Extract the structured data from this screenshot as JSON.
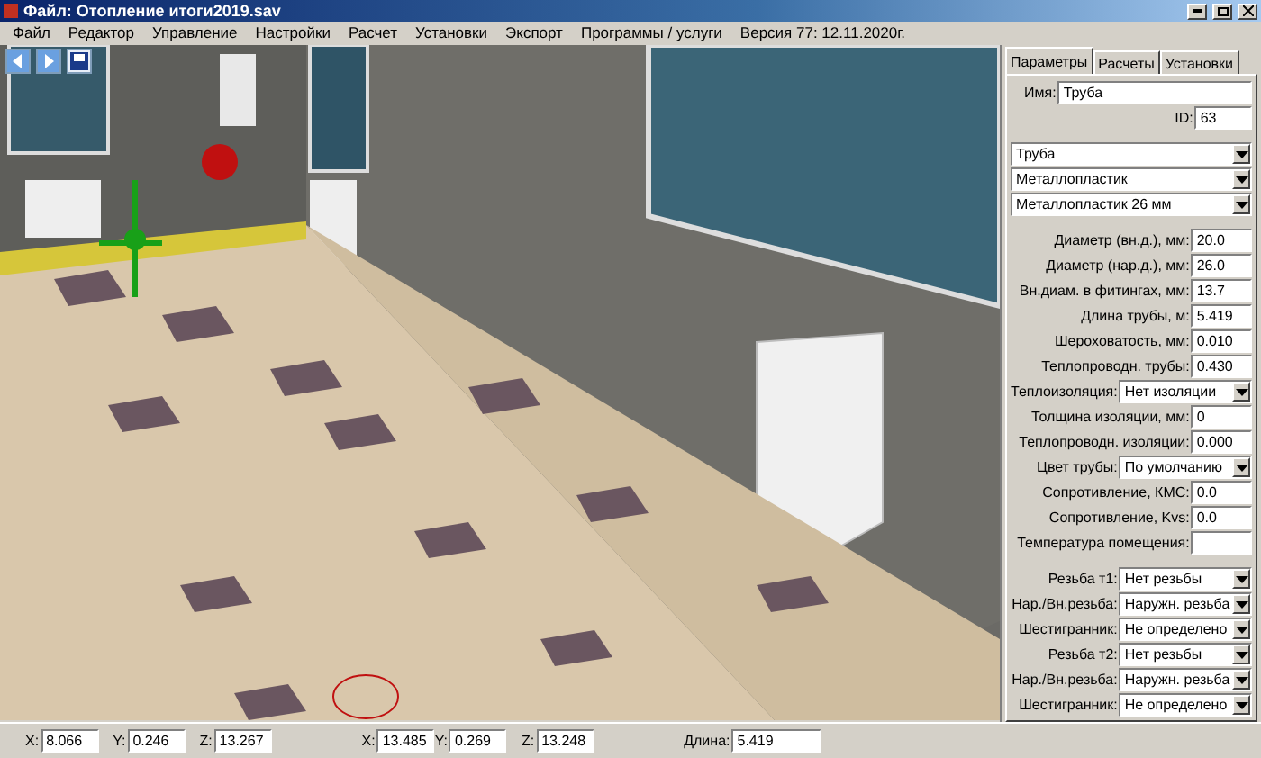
{
  "window": {
    "title": "Файл: Отопление итоги2019.sav"
  },
  "menu": [
    "Файл",
    "Редактор",
    "Управление",
    "Настройки",
    "Расчет",
    "Установки",
    "Экспорт",
    "Программы / услуги",
    "Версия 77: 12.11.2020г."
  ],
  "tabs": [
    {
      "label": "Параметры",
      "selected": true
    },
    {
      "label": "Расчеты",
      "selected": false
    },
    {
      "label": "Установки",
      "selected": false
    }
  ],
  "name_field": {
    "label": "Имя:",
    "value": "Труба"
  },
  "id_field": {
    "label": "ID:",
    "value": "63"
  },
  "sections": [
    {
      "rows": [
        {
          "kind": "dropdown",
          "value": "Труба"
        },
        {
          "kind": "dropdown",
          "value": "Металлопластик"
        },
        {
          "kind": "dropdown",
          "value": "Металлопластик 26 мм"
        }
      ]
    },
    {
      "rows": [
        {
          "kind": "field",
          "label": "Диаметр (вн.д.), мм:",
          "value": "20.0"
        },
        {
          "kind": "field",
          "label": "Диаметр (нар.д.), мм:",
          "value": "26.0"
        },
        {
          "kind": "field",
          "label": "Вн.диам. в фитингах, мм:",
          "value": "13.7"
        },
        {
          "kind": "field",
          "label": "Длина трубы, м:",
          "value": "5.419"
        },
        {
          "kind": "field",
          "label": "Шероховатость, мм:",
          "value": "0.010"
        },
        {
          "kind": "field",
          "label": "Теплопроводн. трубы:",
          "value": "0.430"
        },
        {
          "kind": "select",
          "label": "Теплоизоляция:",
          "value": "Нет изоляции"
        },
        {
          "kind": "field",
          "label": "Толщина изоляции, мм:",
          "value": "0"
        },
        {
          "kind": "field",
          "label": "Теплопроводн. изоляции:",
          "value": "0.000"
        },
        {
          "kind": "select",
          "label": "Цвет трубы:",
          "value": "По умолчанию"
        },
        {
          "kind": "field",
          "label": "Сопротивление, КМС:",
          "value": "0.0"
        },
        {
          "kind": "field",
          "label": "Сопротивление, Kvs:",
          "value": "0.0"
        },
        {
          "kind": "field",
          "label": "Температура помещения:"
        }
      ]
    },
    {
      "rows": [
        {
          "kind": "select",
          "label": "Резьба т1:",
          "value": "Нет резьбы"
        },
        {
          "kind": "select",
          "label": "Нар./Вн.резьба:",
          "value": "Наружн. резьба"
        },
        {
          "kind": "select",
          "label": "Шестигранник:",
          "value": "Не определено"
        },
        {
          "kind": "select",
          "label": "Резьба т2:",
          "value": "Нет резьбы"
        },
        {
          "kind": "select",
          "label": "Нар./Вн.резьба:",
          "value": "Наружн. резьба"
        },
        {
          "kind": "select",
          "label": "Шестигранник:",
          "value": "Не определено"
        }
      ]
    }
  ],
  "status_bar": [
    {
      "label": "X:",
      "value": "8.066"
    },
    {
      "label": "Y:",
      "value": "0.246"
    },
    {
      "label": "Z:",
      "value": "13.267"
    },
    {
      "label": "X:",
      "value": "13.485",
      "gap": true
    },
    {
      "label": "Y:",
      "value": "0.269"
    },
    {
      "label": "Z:",
      "value": "13.248"
    },
    {
      "label": "Длина:",
      "value": "5.419",
      "gap": true
    }
  ]
}
